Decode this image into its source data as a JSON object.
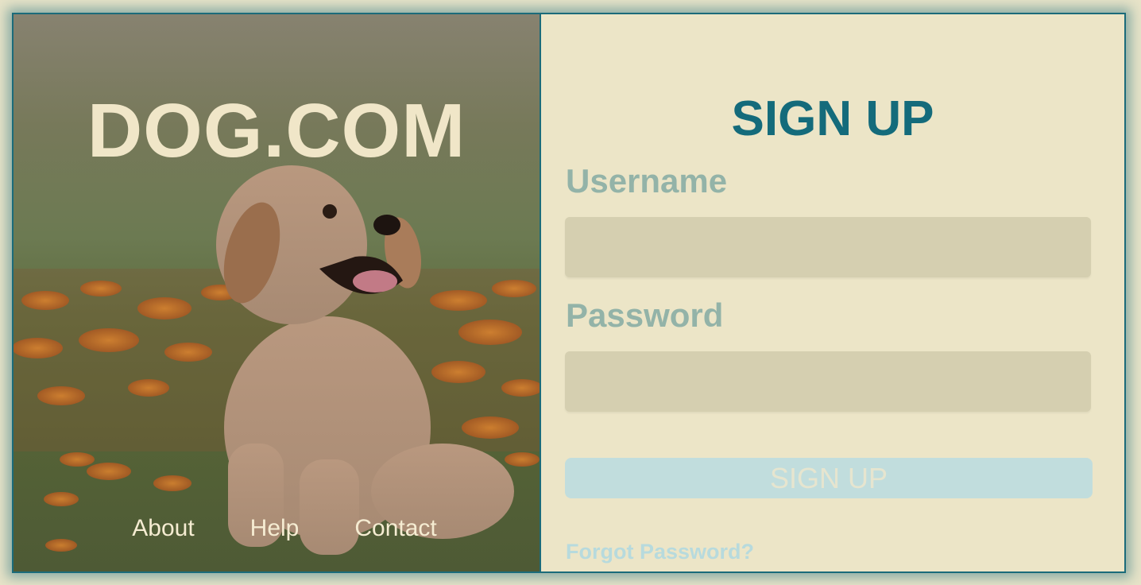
{
  "brand": {
    "title": "DOG.COM"
  },
  "hero_image": {
    "icon": "puppy-photo",
    "description_colors": [
      "#877f6c",
      "#5e6d3e",
      "#c7762c",
      "#b89a7a"
    ]
  },
  "nav": {
    "items": [
      {
        "label": "About"
      },
      {
        "label": "Help"
      },
      {
        "label": "Contact"
      }
    ]
  },
  "form": {
    "title": "SIGN UP",
    "username": {
      "label": "Username",
      "value": "",
      "placeholder": ""
    },
    "password": {
      "label": "Password",
      "value": "",
      "placeholder": ""
    },
    "submit_label": "SIGN UP",
    "forgot_label": "Forgot Password?"
  },
  "colors": {
    "accent": "#146b7b",
    "label": "#93b3a8",
    "input_bg": "#d5cfb0",
    "button_bg": "#c1dddd",
    "panel_bg": "#ece5c7"
  }
}
